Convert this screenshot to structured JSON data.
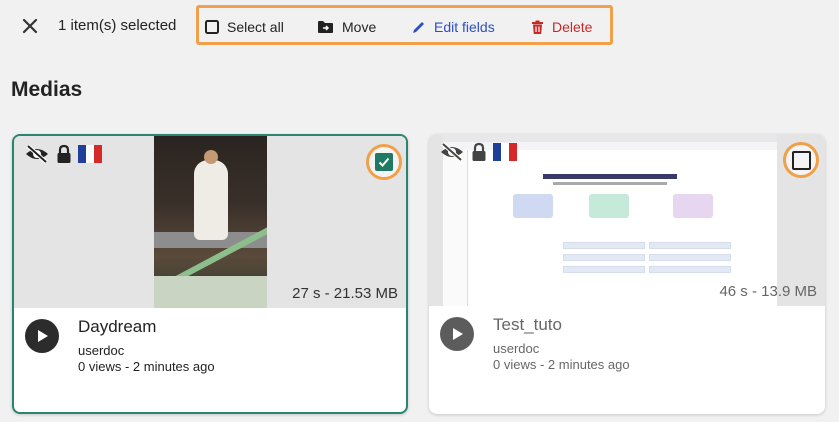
{
  "toolbar": {
    "selection_count": "1 item(s) selected",
    "select_all_label": "Select all",
    "move_label": "Move",
    "edit_fields_label": "Edit fields",
    "delete_label": "Delete"
  },
  "section": {
    "title": "Medias"
  },
  "colors": {
    "highlight": "#f0a048",
    "accent_selected": "#2a8470",
    "edit": "#2c4fc7",
    "delete": "#c62828"
  },
  "medias": [
    {
      "title": "Daydream",
      "duration_size": "27 s - 21.53 MB",
      "author": "userdoc",
      "views": "0 views",
      "separator": " - ",
      "time": "2 minutes ago",
      "selected": true,
      "icons": [
        "eye-off-icon",
        "lock-icon",
        "french-flag-icon"
      ]
    },
    {
      "title": "Test_tuto",
      "duration_size": "46 s - 13.9 MB",
      "author": "userdoc",
      "views": "0 views",
      "separator": " - ",
      "time": "2 minutes ago",
      "selected": false,
      "icons": [
        "eye-off-icon",
        "lock-icon",
        "french-flag-icon"
      ]
    }
  ]
}
